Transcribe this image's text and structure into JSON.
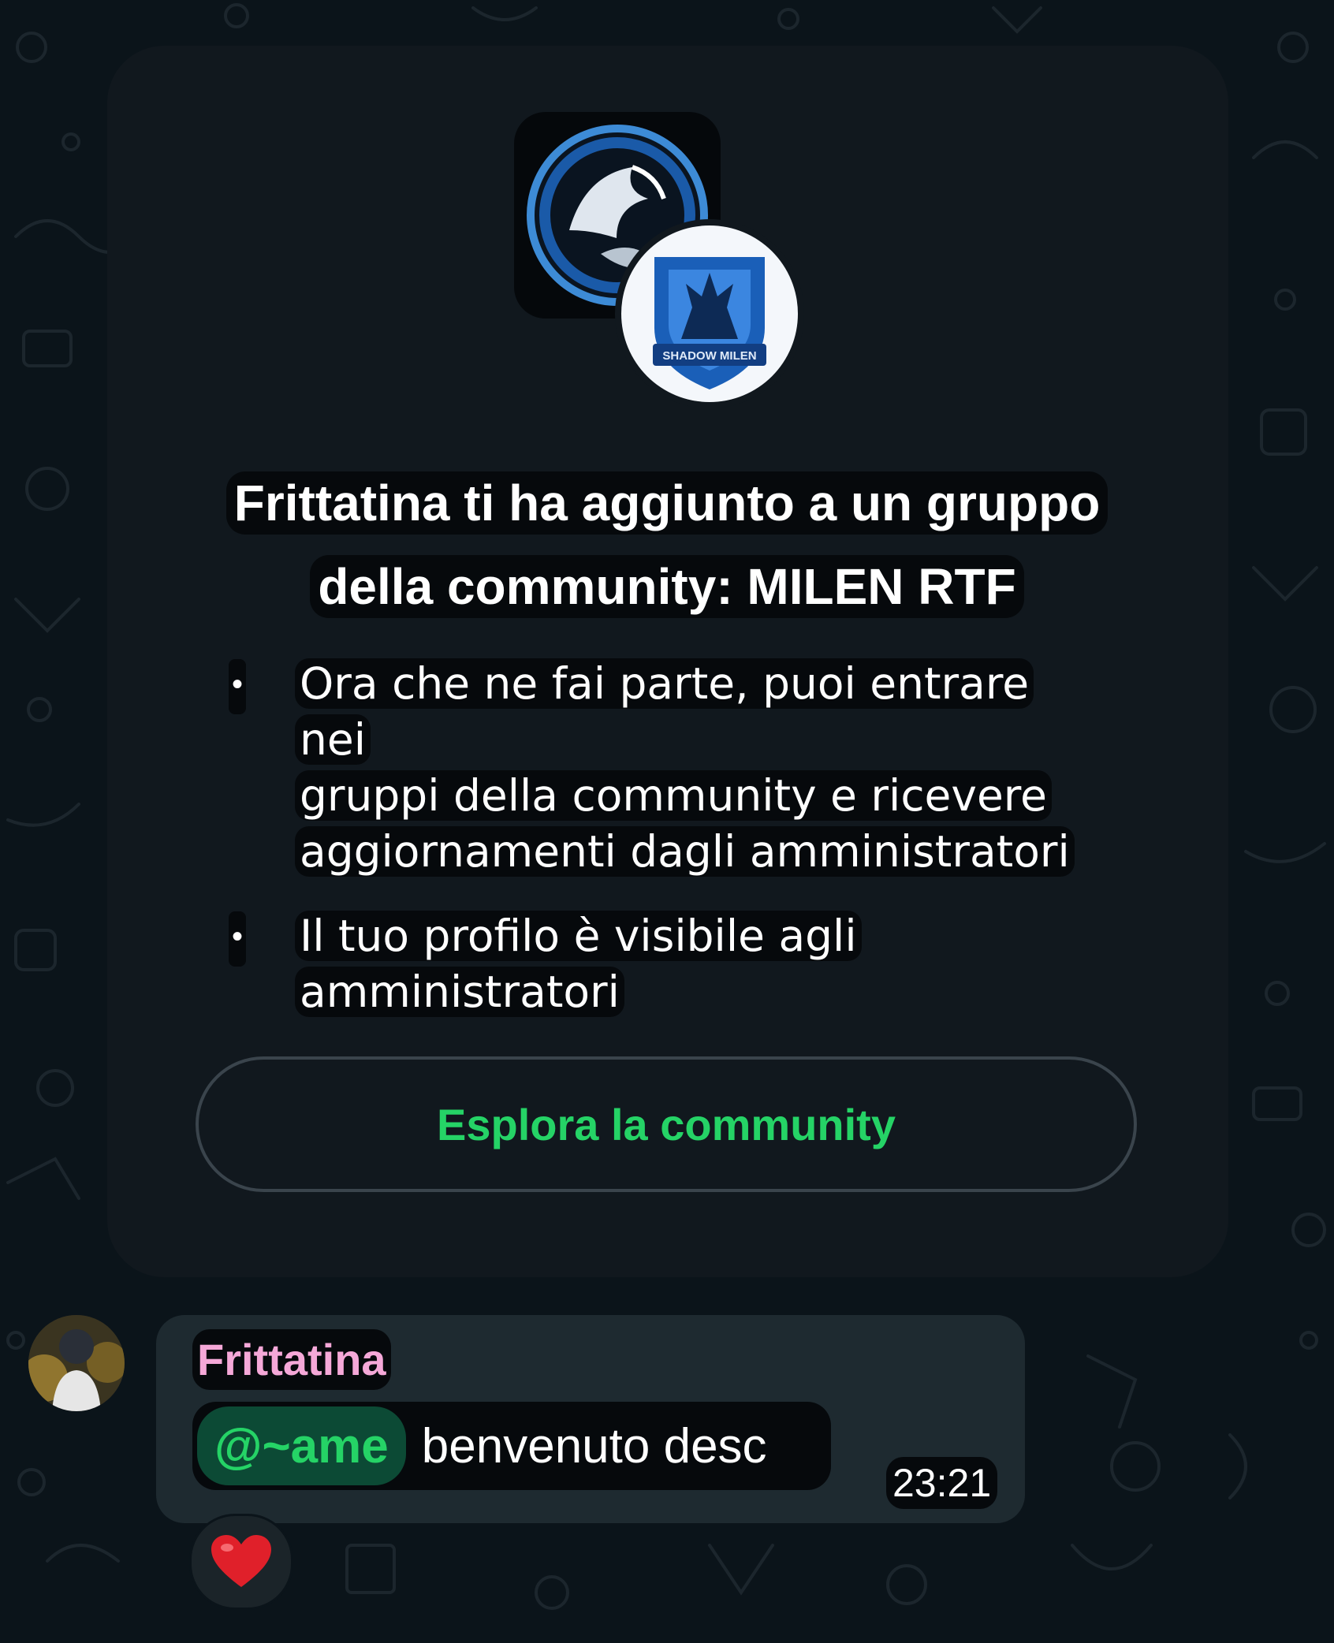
{
  "card": {
    "title_line1": "Frittatina ti ha aggiunto a un gruppo",
    "title_line2": "della community: MILEN RTF",
    "bullets": [
      {
        "line1": "Ora che ne fai parte, puoi entrare nei",
        "line2": "gruppi della community e ricevere",
        "line3": "aggiornamenti dagli amministratori"
      },
      {
        "line1": "Il tuo profilo è visibile agli",
        "line2": "amministratori"
      }
    ],
    "community_badge_text": "SHADOW MILEN",
    "explore_button": "Esplora la community"
  },
  "message": {
    "sender": "Frittatina",
    "mention": "@~ame",
    "text": "benvenuto desc",
    "time": "23:21",
    "reaction": "heart"
  },
  "colors": {
    "background": "#0b141a",
    "card": "#11181e",
    "accent": "#25d366",
    "sender": "#f5a8d8",
    "bubble": "#1e2a30"
  }
}
